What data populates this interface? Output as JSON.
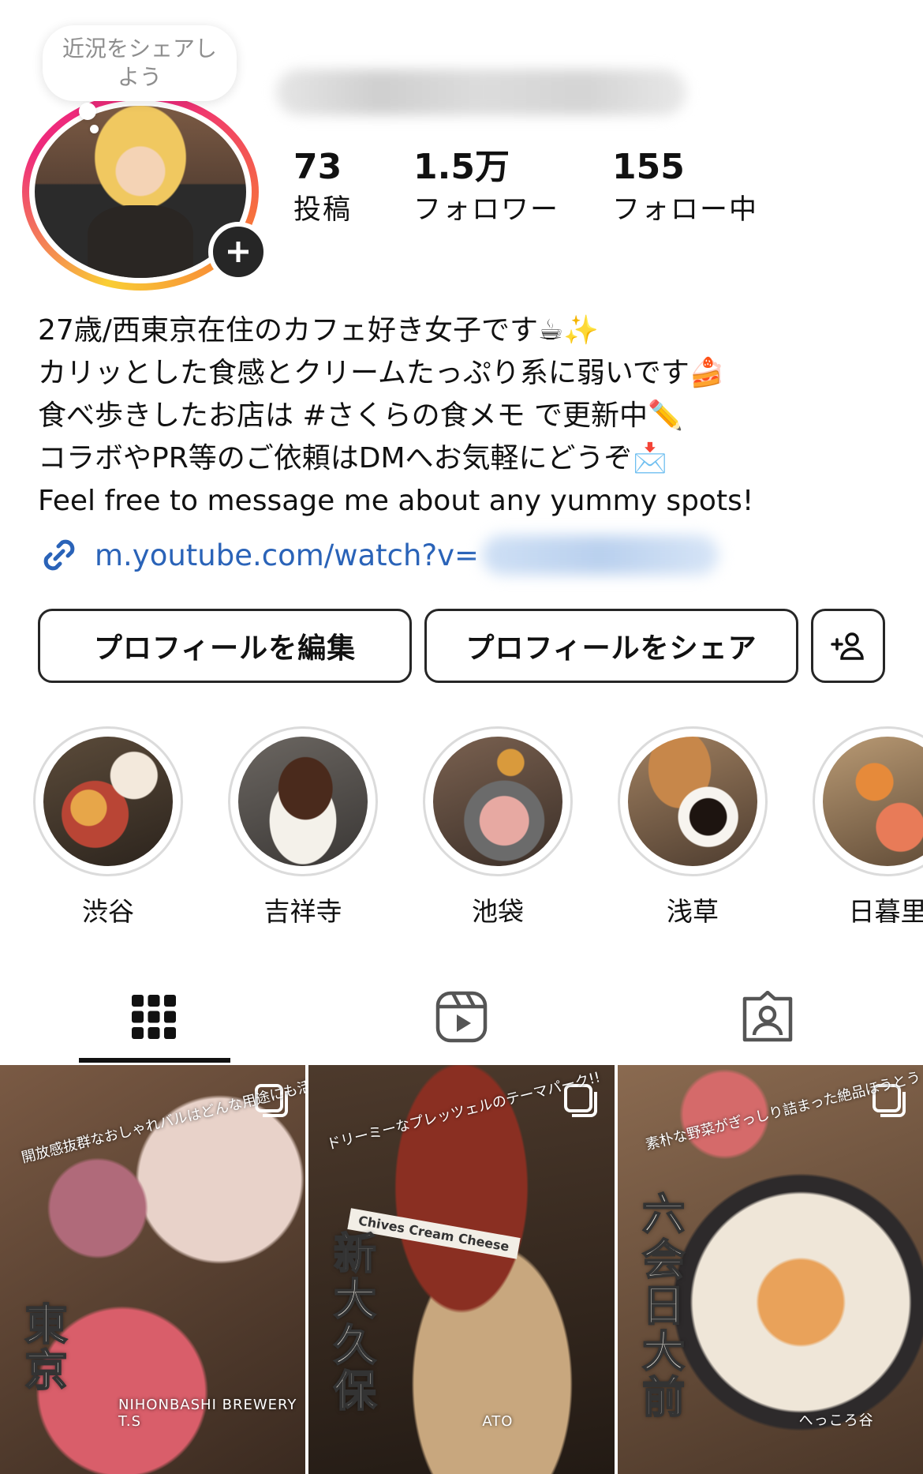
{
  "note": {
    "text": "近況をシェアしよう"
  },
  "profile": {
    "stats": [
      {
        "value": "73",
        "label": "投稿"
      },
      {
        "value": "1.5万",
        "label": "フォロワー"
      },
      {
        "value": "155",
        "label": "フォロー中"
      }
    ],
    "bio": [
      "27歳/西東京在住のカフェ好き女子です☕✨",
      "カリッとした食感とクリームたっぷり系に弱いです🍰",
      "食べ歩きしたお店は #さくらの食メモ で更新中✏️",
      "コラボやPR等のご依頼はDMへお気軽にどうぞ📩",
      "Feel free to message me about any yummy spots!"
    ],
    "link": "m.youtube.com/watch?v="
  },
  "buttons": {
    "edit": "プロフィールを編集",
    "share": "プロフィールをシェア",
    "add_icon": "add-person-icon"
  },
  "highlights": [
    {
      "label": "渋谷"
    },
    {
      "label": "吉祥寺"
    },
    {
      "label": "池袋"
    },
    {
      "label": "浅草"
    },
    {
      "label": "日暮里"
    }
  ],
  "tabs": [
    {
      "icon": "grid-icon",
      "selected": true
    },
    {
      "icon": "reels-icon",
      "selected": false
    },
    {
      "icon": "tagged-icon",
      "selected": false
    }
  ],
  "posts": [
    {
      "overlay": "東京",
      "location": "NIHONBASHI BREWERY T.S",
      "caption": "開放感抜群なおしゃれバルはどんな用途にも活躍間違いなし!"
    },
    {
      "overlay": "新大久保",
      "location": "ATO",
      "caption": "ドリーミーなプレッツェルのテーマパーク!!",
      "sign": "Chives Cream Cheese"
    },
    {
      "overlay": "六会日大前",
      "location": "へっころ谷",
      "caption": "素朴な野菜がぎっしり詰まった絶品ほうとう"
    }
  ],
  "colors": {
    "link": "#2a63b8",
    "accent": "#ee2a7b"
  }
}
